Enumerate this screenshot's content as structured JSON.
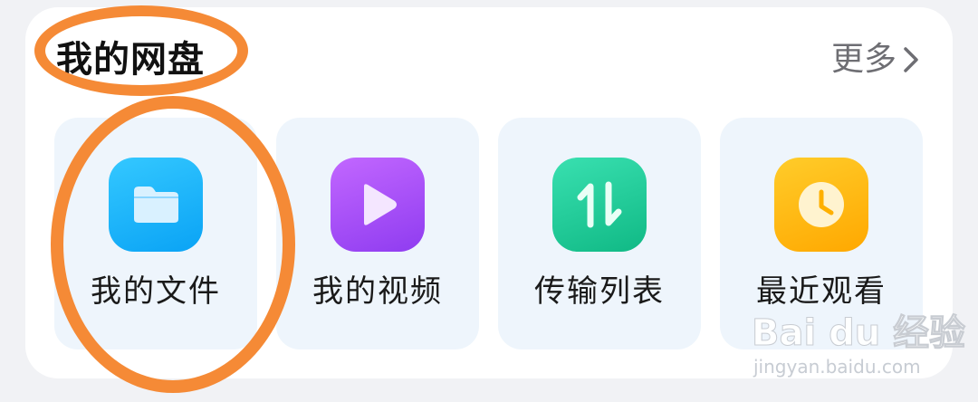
{
  "card": {
    "title": "我的网盘",
    "more_label": "更多"
  },
  "tiles": [
    {
      "label": "我的文件",
      "icon": "folder-icon",
      "color": "#1fb6ff"
    },
    {
      "label": "我的视频",
      "icon": "play-icon",
      "color": "#a64df6"
    },
    {
      "label": "传输列表",
      "icon": "transfer-arrows-icon",
      "color": "#18c98f"
    },
    {
      "label": "最近观看",
      "icon": "clock-icon",
      "color": "#ffb400"
    }
  ],
  "annotation_color": "#f58a36",
  "watermark": {
    "logo_text": "Bai du 经验",
    "url": "jingyan.baidu.com"
  }
}
